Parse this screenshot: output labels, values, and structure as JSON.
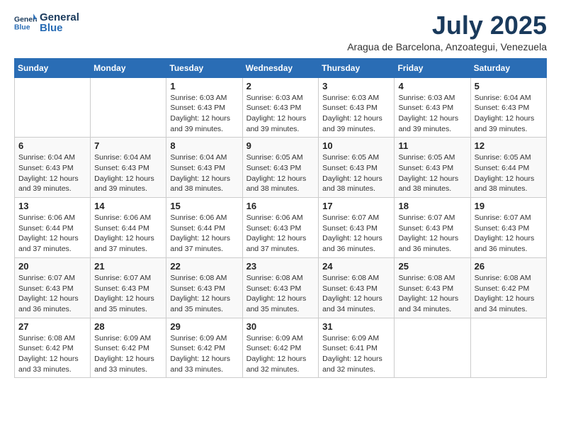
{
  "header": {
    "logo_line1": "General",
    "logo_line2": "Blue",
    "month": "July 2025",
    "location": "Aragua de Barcelona, Anzoategui, Venezuela"
  },
  "days_of_week": [
    "Sunday",
    "Monday",
    "Tuesday",
    "Wednesday",
    "Thursday",
    "Friday",
    "Saturday"
  ],
  "weeks": [
    [
      {
        "day": "",
        "text": ""
      },
      {
        "day": "",
        "text": ""
      },
      {
        "day": "1",
        "text": "Sunrise: 6:03 AM\nSunset: 6:43 PM\nDaylight: 12 hours and 39 minutes."
      },
      {
        "day": "2",
        "text": "Sunrise: 6:03 AM\nSunset: 6:43 PM\nDaylight: 12 hours and 39 minutes."
      },
      {
        "day": "3",
        "text": "Sunrise: 6:03 AM\nSunset: 6:43 PM\nDaylight: 12 hours and 39 minutes."
      },
      {
        "day": "4",
        "text": "Sunrise: 6:03 AM\nSunset: 6:43 PM\nDaylight: 12 hours and 39 minutes."
      },
      {
        "day": "5",
        "text": "Sunrise: 6:04 AM\nSunset: 6:43 PM\nDaylight: 12 hours and 39 minutes."
      }
    ],
    [
      {
        "day": "6",
        "text": "Sunrise: 6:04 AM\nSunset: 6:43 PM\nDaylight: 12 hours and 39 minutes."
      },
      {
        "day": "7",
        "text": "Sunrise: 6:04 AM\nSunset: 6:43 PM\nDaylight: 12 hours and 39 minutes."
      },
      {
        "day": "8",
        "text": "Sunrise: 6:04 AM\nSunset: 6:43 PM\nDaylight: 12 hours and 38 minutes."
      },
      {
        "day": "9",
        "text": "Sunrise: 6:05 AM\nSunset: 6:43 PM\nDaylight: 12 hours and 38 minutes."
      },
      {
        "day": "10",
        "text": "Sunrise: 6:05 AM\nSunset: 6:43 PM\nDaylight: 12 hours and 38 minutes."
      },
      {
        "day": "11",
        "text": "Sunrise: 6:05 AM\nSunset: 6:43 PM\nDaylight: 12 hours and 38 minutes."
      },
      {
        "day": "12",
        "text": "Sunrise: 6:05 AM\nSunset: 6:44 PM\nDaylight: 12 hours and 38 minutes."
      }
    ],
    [
      {
        "day": "13",
        "text": "Sunrise: 6:06 AM\nSunset: 6:44 PM\nDaylight: 12 hours and 37 minutes."
      },
      {
        "day": "14",
        "text": "Sunrise: 6:06 AM\nSunset: 6:44 PM\nDaylight: 12 hours and 37 minutes."
      },
      {
        "day": "15",
        "text": "Sunrise: 6:06 AM\nSunset: 6:44 PM\nDaylight: 12 hours and 37 minutes."
      },
      {
        "day": "16",
        "text": "Sunrise: 6:06 AM\nSunset: 6:43 PM\nDaylight: 12 hours and 37 minutes."
      },
      {
        "day": "17",
        "text": "Sunrise: 6:07 AM\nSunset: 6:43 PM\nDaylight: 12 hours and 36 minutes."
      },
      {
        "day": "18",
        "text": "Sunrise: 6:07 AM\nSunset: 6:43 PM\nDaylight: 12 hours and 36 minutes."
      },
      {
        "day": "19",
        "text": "Sunrise: 6:07 AM\nSunset: 6:43 PM\nDaylight: 12 hours and 36 minutes."
      }
    ],
    [
      {
        "day": "20",
        "text": "Sunrise: 6:07 AM\nSunset: 6:43 PM\nDaylight: 12 hours and 36 minutes."
      },
      {
        "day": "21",
        "text": "Sunrise: 6:07 AM\nSunset: 6:43 PM\nDaylight: 12 hours and 35 minutes."
      },
      {
        "day": "22",
        "text": "Sunrise: 6:08 AM\nSunset: 6:43 PM\nDaylight: 12 hours and 35 minutes."
      },
      {
        "day": "23",
        "text": "Sunrise: 6:08 AM\nSunset: 6:43 PM\nDaylight: 12 hours and 35 minutes."
      },
      {
        "day": "24",
        "text": "Sunrise: 6:08 AM\nSunset: 6:43 PM\nDaylight: 12 hours and 34 minutes."
      },
      {
        "day": "25",
        "text": "Sunrise: 6:08 AM\nSunset: 6:43 PM\nDaylight: 12 hours and 34 minutes."
      },
      {
        "day": "26",
        "text": "Sunrise: 6:08 AM\nSunset: 6:42 PM\nDaylight: 12 hours and 34 minutes."
      }
    ],
    [
      {
        "day": "27",
        "text": "Sunrise: 6:08 AM\nSunset: 6:42 PM\nDaylight: 12 hours and 33 minutes."
      },
      {
        "day": "28",
        "text": "Sunrise: 6:09 AM\nSunset: 6:42 PM\nDaylight: 12 hours and 33 minutes."
      },
      {
        "day": "29",
        "text": "Sunrise: 6:09 AM\nSunset: 6:42 PM\nDaylight: 12 hours and 33 minutes."
      },
      {
        "day": "30",
        "text": "Sunrise: 6:09 AM\nSunset: 6:42 PM\nDaylight: 12 hours and 32 minutes."
      },
      {
        "day": "31",
        "text": "Sunrise: 6:09 AM\nSunset: 6:41 PM\nDaylight: 12 hours and 32 minutes."
      },
      {
        "day": "",
        "text": ""
      },
      {
        "day": "",
        "text": ""
      }
    ]
  ]
}
